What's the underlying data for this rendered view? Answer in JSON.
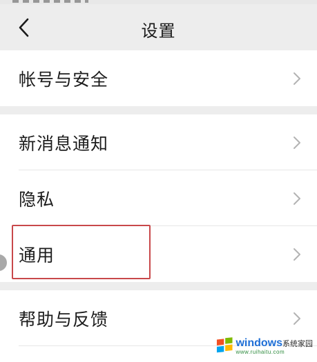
{
  "navbar": {
    "title": "设置"
  },
  "groups": [
    {
      "items": [
        {
          "label": "帐号与安全"
        }
      ]
    },
    {
      "items": [
        {
          "label": "新消息通知"
        },
        {
          "label": "隐私"
        },
        {
          "label": "通用"
        }
      ]
    },
    {
      "items": [
        {
          "label": "帮助与反馈"
        }
      ]
    }
  ],
  "watermark": {
    "main": "windows",
    "suffix": "系统家园",
    "sub": "www.ruihaitu.com"
  },
  "colors": {
    "background": "#ededed",
    "row": "#ffffff",
    "highlight": "#c8484a",
    "chevron": "#b3b3b3"
  }
}
